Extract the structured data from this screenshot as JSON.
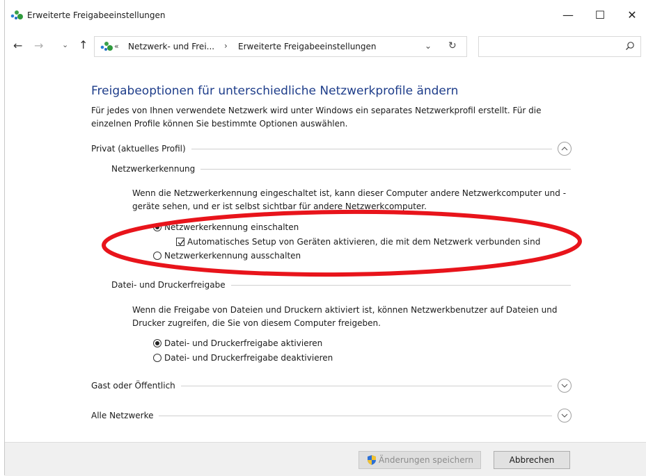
{
  "window": {
    "title": "Erweiterte Freigabeeinstellungen",
    "minimize": "—",
    "maximize": "☐",
    "close": "✕"
  },
  "nav": {
    "back": "←",
    "forward": "→",
    "recent": "⌄",
    "up": "↑",
    "address": {
      "overflow": "«",
      "crumb1": "Netzwerk- und Frei...",
      "separator": "›",
      "crumb2": "Erweiterte Freigabeeinstellungen",
      "dropdown": "⌄",
      "refresh": "↻"
    },
    "search_placeholder": ""
  },
  "content": {
    "heading": "Freigabeoptionen für unterschiedliche Netzwerkprofile ändern",
    "intro": "Für jedes von Ihnen verwendete Netzwerk wird unter Windows ein separates Netzwerkprofil erstellt. Für die einzelnen Profile können Sie bestimmte Optionen auswählen.",
    "private_profile": {
      "label": "Privat (aktuelles Profil)",
      "expanded": true,
      "network_discovery": {
        "label": "Netzwerkerkennung",
        "description": "Wenn die Netzwerkerkennung eingeschaltet ist, kann dieser Computer andere Netzwerkcomputer und -geräte sehen, und er ist selbst sichtbar für andere Netzwerkcomputer.",
        "option_on": "Netzwerkerkennung einschalten",
        "option_on_selected": true,
        "auto_setup": "Automatisches Setup von Geräten aktivieren, die mit dem Netzwerk verbunden sind",
        "auto_setup_checked": true,
        "option_off": "Netzwerkerkennung ausschalten",
        "option_off_selected": false
      },
      "file_sharing": {
        "label": "Datei- und Druckerfreigabe",
        "description": "Wenn die Freigabe von Dateien und Druckern aktiviert ist, können Netzwerkbenutzer auf Dateien und Drucker zugreifen, die Sie von diesem Computer freigeben.",
        "option_on": "Datei- und Druckerfreigabe aktivieren",
        "option_on_selected": true,
        "option_off": "Datei- und Druckerfreigabe deaktivieren",
        "option_off_selected": false
      }
    },
    "guest_profile": {
      "label": "Gast oder Öffentlich",
      "expanded": false
    },
    "all_networks": {
      "label": "Alle Netzwerke",
      "expanded": false
    }
  },
  "footer": {
    "save_label": "Änderungen speichern",
    "save_enabled": false,
    "cancel_label": "Abbrechen"
  },
  "annotation": {
    "color": "#e8141b"
  },
  "colors": {
    "heading": "#1e3d8a",
    "footer_bg": "#f0f0f0"
  }
}
